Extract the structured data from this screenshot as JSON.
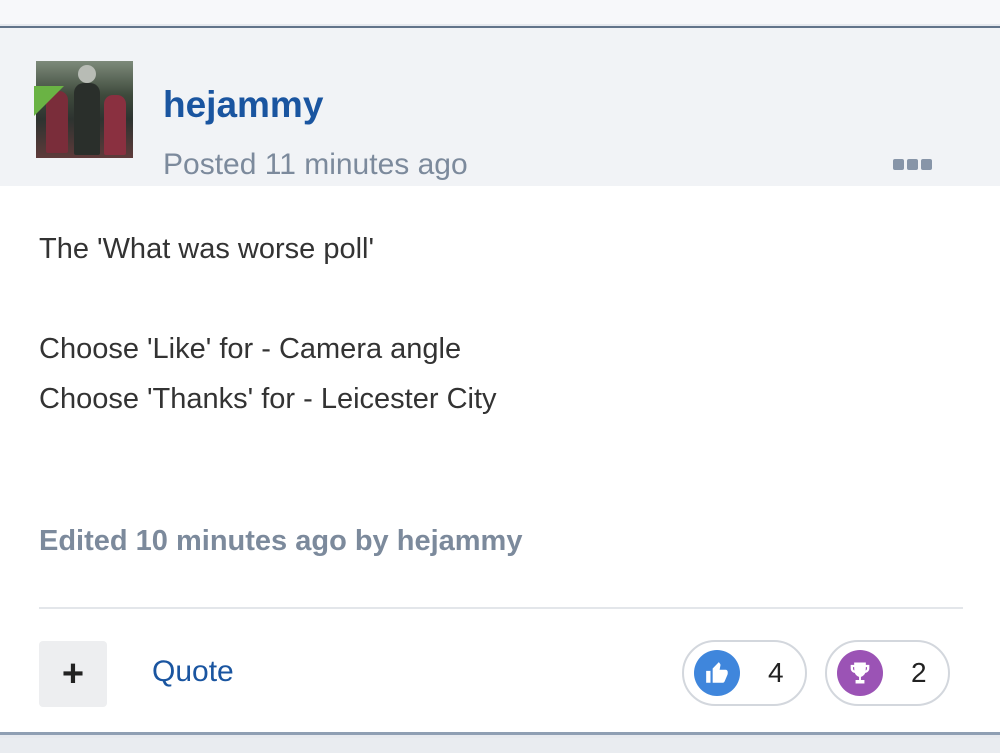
{
  "post": {
    "author": "hejammy",
    "posted": "Posted 11 minutes ago",
    "content": {
      "line1": "The 'What was worse poll'",
      "line2": "Choose 'Like' for - Camera angle",
      "line3": "Choose 'Thanks' for - Leicester City"
    },
    "edited": "Edited 10 minutes ago by hejammy",
    "footer": {
      "plus_label": "+",
      "quote_label": "Quote"
    },
    "reactions": [
      {
        "icon": "thumbs-up-icon",
        "count": "4",
        "color": "#3f86dc"
      },
      {
        "icon": "trophy-icon",
        "count": "2",
        "color": "#9b53b5"
      }
    ]
  }
}
